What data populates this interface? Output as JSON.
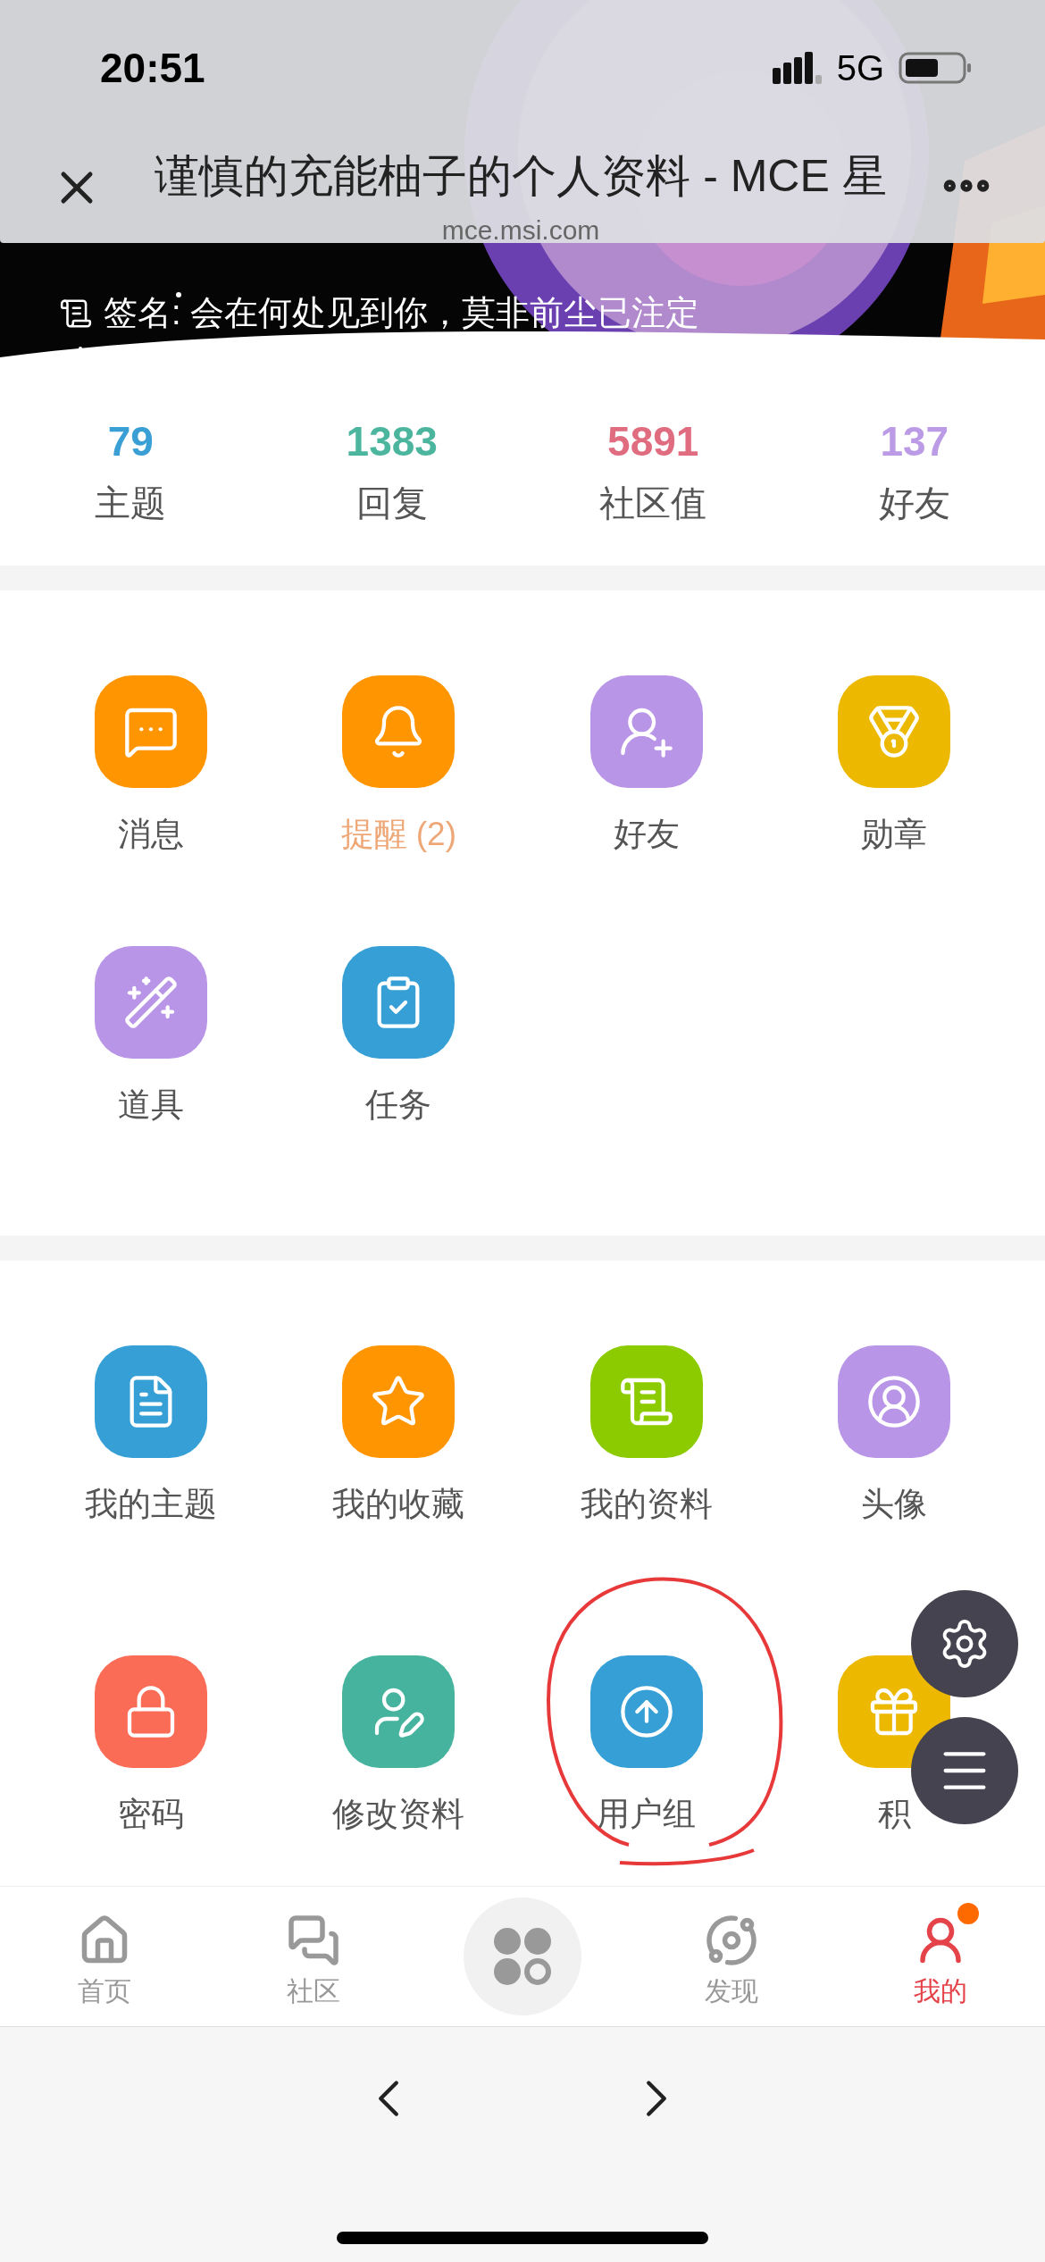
{
  "status_bar": {
    "time": "20:51",
    "network": "5G"
  },
  "browser_bar": {
    "title": "谨慎的充能柚子的个人资料 - MCE 星",
    "url": "mce.msi.com"
  },
  "profile": {
    "signature": "签名: 会在何处见到你，莫非前尘已注定"
  },
  "stats": [
    {
      "value": "79",
      "label": "主题",
      "color": "#3a9fd4"
    },
    {
      "value": "1383",
      "label": "回复",
      "color": "#4bb59d"
    },
    {
      "value": "5891",
      "label": "社区值",
      "color": "#e06c80"
    },
    {
      "value": "137",
      "label": "好友",
      "color": "#bb9ae6"
    }
  ],
  "menu_grid_1": [
    {
      "label": "消息",
      "color": "#ff9500",
      "faded": false
    },
    {
      "label": "提醒 (2)",
      "color": "#ff9500",
      "faded": true
    },
    {
      "label": "好友",
      "color": "#b995e8",
      "faded": false
    },
    {
      "label": "勋章",
      "color": "#ecb800",
      "faded": false
    },
    {
      "label": "道具",
      "color": "#b995e8",
      "faded": false
    },
    {
      "label": "任务",
      "color": "#36a0d6",
      "faded": false
    }
  ],
  "menu_grid_2": [
    {
      "label": "我的主题",
      "color": "#36a0d6",
      "circled": false
    },
    {
      "label": "我的收藏",
      "color": "#ff9500",
      "circled": false
    },
    {
      "label": "我的资料",
      "color": "#8ccb00",
      "circled": false
    },
    {
      "label": "头像",
      "color": "#b995e8",
      "circled": false
    },
    {
      "label": "密码",
      "color": "#fb6c57",
      "circled": false
    },
    {
      "label": "修改资料",
      "color": "#45b39d",
      "circled": false
    },
    {
      "label": "用户组",
      "color": "#36a0d6",
      "circled": true
    },
    {
      "label": "积",
      "color": "#ecb800",
      "circled": false
    }
  ],
  "tab_bar": [
    {
      "label": "首页",
      "selected": false,
      "badge": false
    },
    {
      "label": "社区",
      "selected": false,
      "badge": false
    },
    {
      "label": "发现",
      "selected": false,
      "badge": false
    },
    {
      "label": "我的",
      "selected": true,
      "badge": true
    }
  ]
}
